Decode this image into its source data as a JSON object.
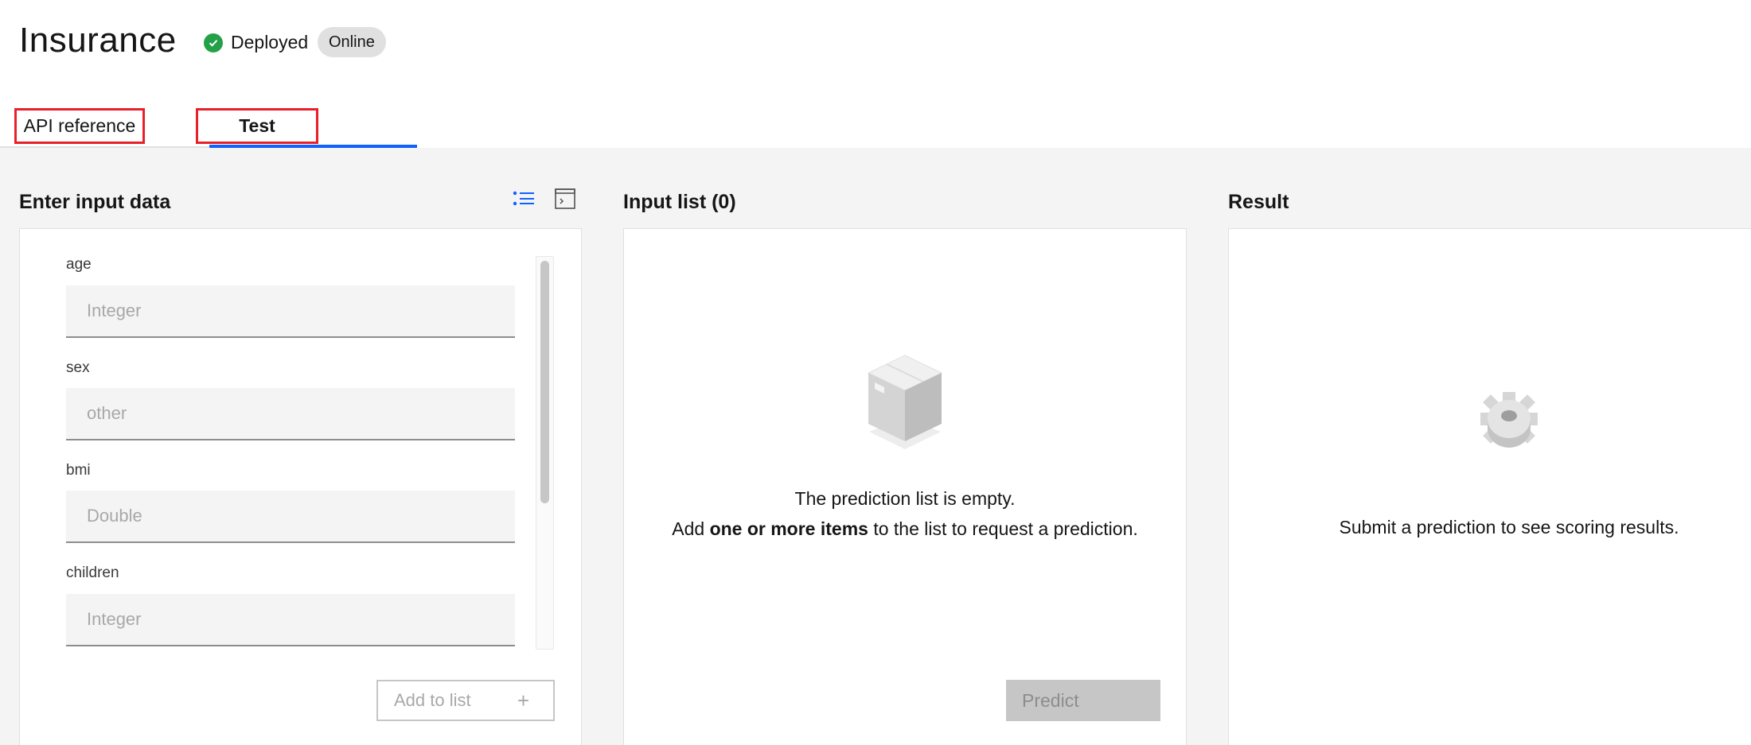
{
  "header": {
    "title": "Insurance",
    "status_label": "Deployed",
    "badge": "Online"
  },
  "tabs": [
    {
      "label": "API reference",
      "active": false
    },
    {
      "label": "Test",
      "active": true
    }
  ],
  "input_panel": {
    "title": "Enter input data",
    "fields": [
      {
        "label": "age",
        "placeholder": "Integer"
      },
      {
        "label": "sex",
        "placeholder": "other"
      },
      {
        "label": "bmi",
        "placeholder": "Double"
      },
      {
        "label": "children",
        "placeholder": "Integer"
      }
    ],
    "add_button_label": "Add to list",
    "add_button_icon": "plus-icon"
  },
  "input_list": {
    "title": "Input list (0)",
    "empty_line1": "The prediction list is empty.",
    "empty_line2_prefix": "Add ",
    "empty_line2_bold": "one or more items",
    "empty_line2_suffix": " to the list to request a prediction.",
    "predict_label": "Predict",
    "illustration": "box-icon"
  },
  "result": {
    "title": "Result",
    "message": "Submit a prediction to see scoring results.",
    "illustration": "gear-icon"
  },
  "colors": {
    "accent": "#0f62fe",
    "success": "#24a148",
    "highlight_border": "#e8202a"
  }
}
